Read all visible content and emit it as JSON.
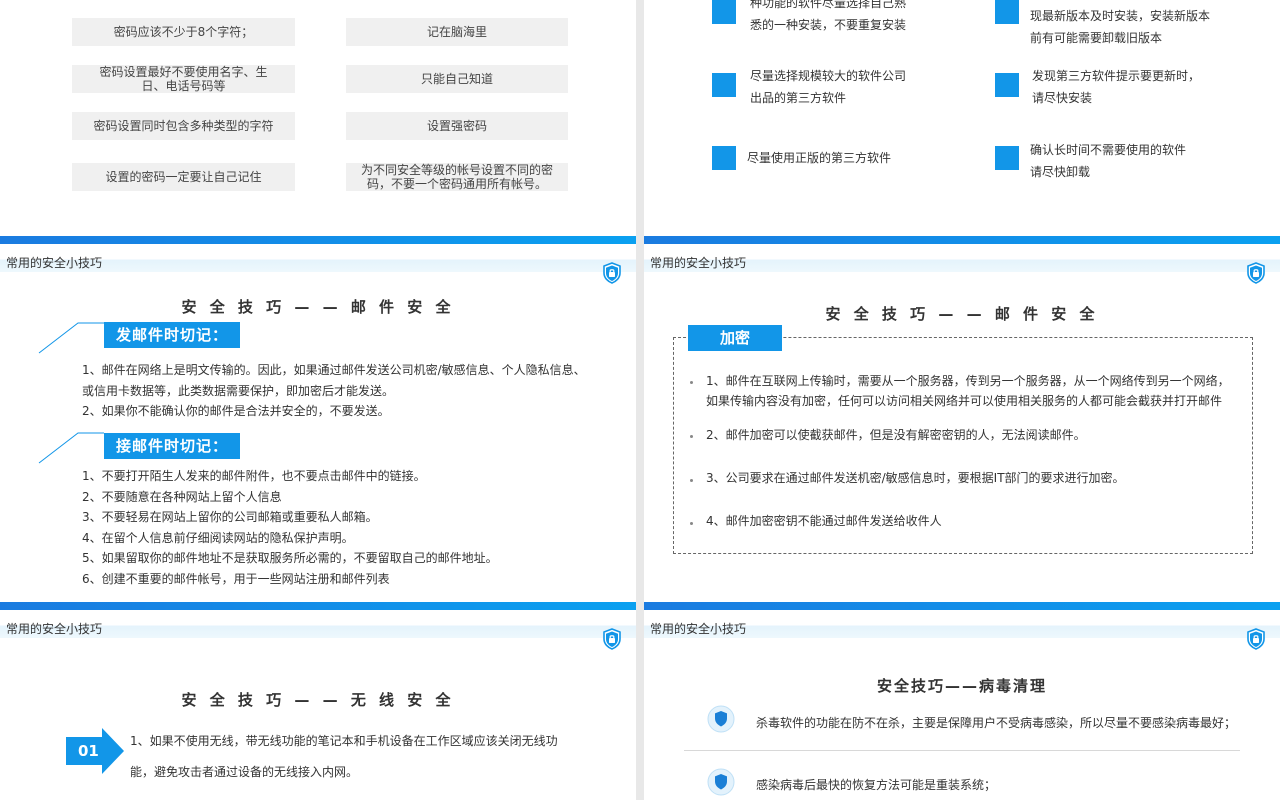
{
  "common": {
    "section_title": "常用的安全小技巧",
    "accent": "#1296e8"
  },
  "slide1": {
    "left_boxes": [
      "密码应该不少于8个字符；",
      "密码设置最好不要使用名字、生日、电话号码等",
      "密码设置同时包含多种类型的字符",
      "设置的密码一定要让自己记住"
    ],
    "right_boxes": [
      "记在脑海里",
      "只能自己知道",
      "设置强密码",
      "为不同安全等级的帐号设置不同的密码，不要一个密码通用所有帐号。"
    ]
  },
  "slide2": {
    "left_items": [
      [
        "种功能的软件尽量选择自己熟",
        "悉的一种安装，不要重复安装"
      ],
      [
        "尽量选择规模较大的软件公司",
        "出品的第三方软件"
      ],
      [
        "尽量使用正版的第三方软件"
      ]
    ],
    "right_items": [
      [
        "现最新版本及时安装，安装新版本",
        "前有可能需要卸载旧版本"
      ],
      [
        "发现第三方软件提示要更新时，",
        "请尽快安装"
      ],
      [
        "确认长时间不需要使用的软件",
        "请尽快卸载"
      ]
    ]
  },
  "slide3": {
    "title": "安 全 技 巧 — — 邮 件 安 全",
    "send_tag": "发邮件时切记：",
    "send_items": [
      "1、邮件在网络上是明文传输的。因此，如果通过邮件发送公司机密/敏感信息、个人隐私信息、",
      "或信用卡数据等，此类数据需要保护，即加密后才能发送。",
      "2、如果你不能确认你的邮件是合法并安全的，不要发送。"
    ],
    "receive_tag": "接邮件时切记：",
    "receive_items": [
      "1、不要打开陌生人发来的邮件附件，也不要点击邮件中的链接。",
      "2、不要随意在各种网站上留个人信息",
      "3、不要轻易在网站上留你的公司邮箱或重要私人邮箱。",
      "4、在留个人信息前仔细阅读网站的隐私保护声明。",
      "5、如果留取你的邮件地址不是获取服务所必需的，不要留取自己的邮件地址。",
      "6、创建不重要的邮件帐号，用于一些网站注册和邮件列表"
    ]
  },
  "slide4": {
    "title": "安 全 技 巧 — — 邮 件 安 全",
    "tag": "加密",
    "items": [
      [
        "1、邮件在互联网上传输时，需要从一个服务器，传到另一个服务器，从一个网络传到另一个网络，",
        "如果传输内容没有加密，任何可以访问相关网络并可以使用相关服务的人都可能会截获并打开邮件"
      ],
      [
        "2、邮件加密可以使截获邮件，但是没有解密密钥的人，无法阅读邮件。"
      ],
      [
        "3、公司要求在通过邮件发送机密/敏感信息时，要根据IT部门的要求进行加密。"
      ],
      [
        "4、邮件加密密钥不能通过邮件发送给收件人"
      ]
    ]
  },
  "slide5": {
    "title": "安 全 技 巧 — — 无 线 安 全",
    "number": "01",
    "lines": [
      "1、如果不使用无线，带无线功能的笔记本和手机设备在工作区域应该关闭无线功",
      "能，避免攻击者通过设备的无线接入内网。"
    ]
  },
  "slide6": {
    "title": "安全技巧——病毒清理",
    "items": [
      "杀毒软件的功能在防不在杀，主要是保障用户不受病毒感染，所以尽量不要感染病毒最好；",
      "感染病毒后最快的恢复方法可能是重装系统；"
    ]
  }
}
